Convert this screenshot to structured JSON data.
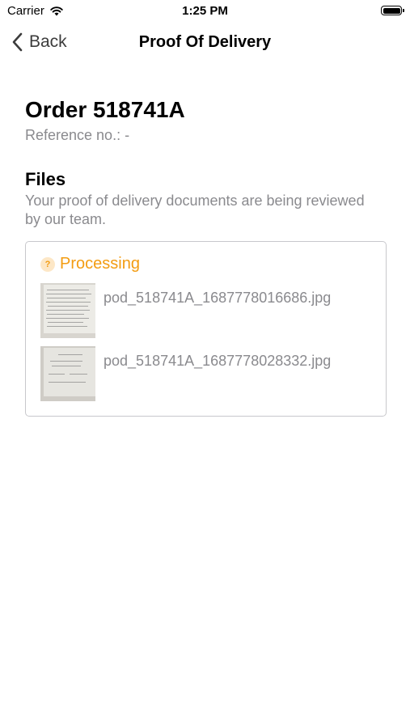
{
  "status_bar": {
    "carrier": "Carrier",
    "wifi_icon": "wifi-icon",
    "time": "1:25 PM",
    "battery_icon": "battery-icon"
  },
  "nav": {
    "back_label": "Back",
    "back_icon": "chevron-left-icon",
    "title": "Proof Of Delivery"
  },
  "order": {
    "title": "Order 518741A",
    "reference": "Reference no.: -"
  },
  "files": {
    "heading": "Files",
    "description": "Your proof of delivery documents are being reviewed by our team.",
    "status": {
      "icon": "question-icon",
      "icon_glyph": "?",
      "label": "Processing",
      "color": "#f39c12"
    },
    "items": [
      {
        "name": "pod_518741A_1687778016686.jpg"
      },
      {
        "name": "pod_518741A_1687778028332.jpg"
      }
    ]
  }
}
